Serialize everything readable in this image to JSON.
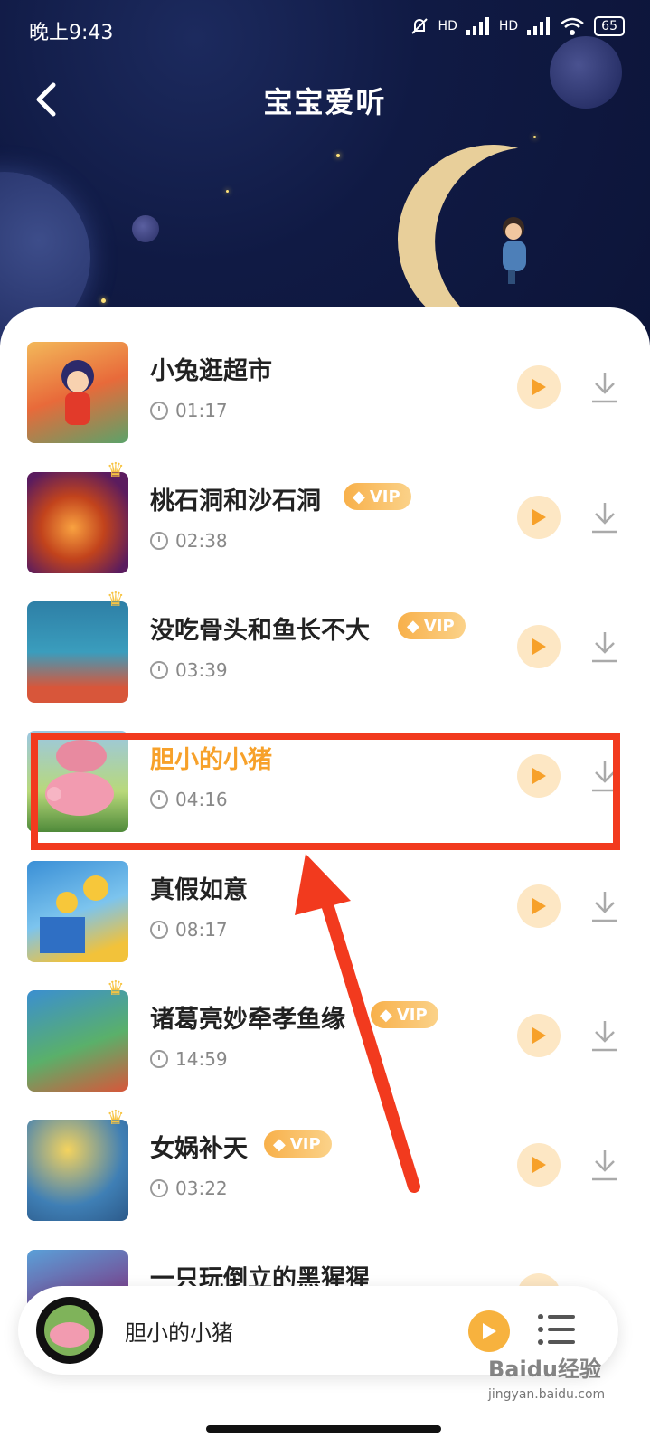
{
  "status_bar": {
    "time": "晚上9:43",
    "battery": "65",
    "signal_labels": [
      "HD",
      "HD"
    ]
  },
  "header": {
    "title": "宝宝爱听"
  },
  "tracks": [
    {
      "title": "小兔逛超市",
      "duration": "01:17",
      "vip": false,
      "active": false
    },
    {
      "title": "桃石洞和沙石洞",
      "duration": "02:38",
      "vip": true,
      "vip_label": "VIP",
      "active": false
    },
    {
      "title": "没吃骨头和鱼长不大",
      "duration": "03:39",
      "vip": true,
      "vip_label": "VIP",
      "active": false
    },
    {
      "title": "胆小的小猪",
      "duration": "04:16",
      "vip": false,
      "active": true
    },
    {
      "title": "真假如意",
      "duration": "08:17",
      "vip": false,
      "active": false
    },
    {
      "title": "诸葛亮妙牵孝鱼缘",
      "duration": "14:59",
      "vip": true,
      "vip_label": "VIP",
      "active": false
    },
    {
      "title": "女娲补天",
      "duration": "03:22",
      "vip": true,
      "vip_label": "VIP",
      "active": false
    },
    {
      "title": "一只玩倒立的黑猩猩",
      "duration": "",
      "vip": false,
      "active": false
    }
  ],
  "player": {
    "now_playing": "胆小的小猪"
  },
  "watermark": {
    "brand": "Baidu经验",
    "url": "jingyan.baidu.com"
  },
  "colors": {
    "accent": "#f7a12a",
    "highlight_box": "#f23a1e",
    "vip_start": "#f8b04a",
    "vip_end": "#fbd289"
  },
  "icons": [
    "back-arrow-icon",
    "play-icon",
    "download-icon",
    "clock-icon",
    "crown-icon",
    "vip-diamond-icon",
    "playlist-icon"
  ]
}
